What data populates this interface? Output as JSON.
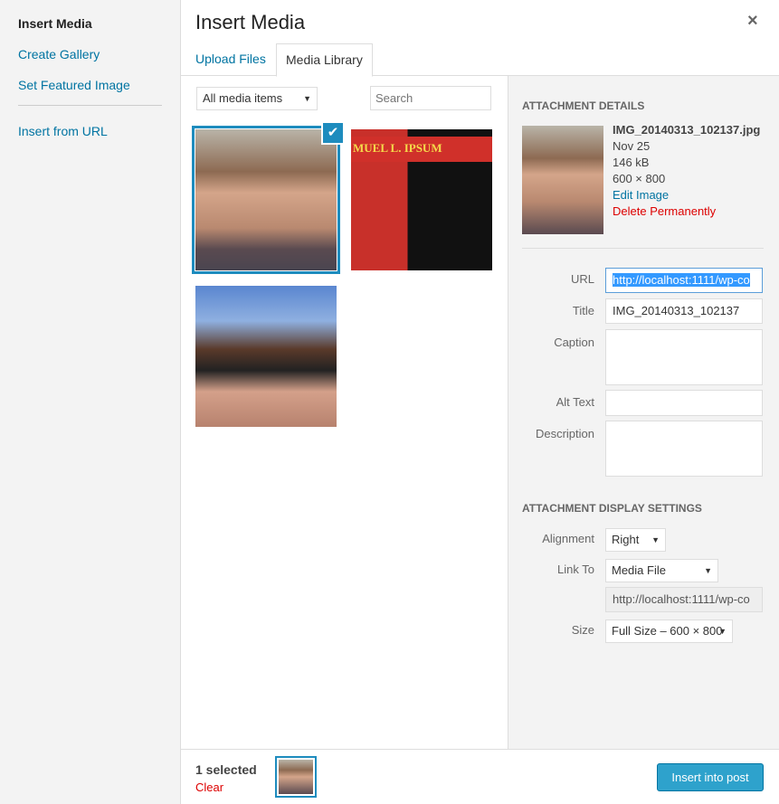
{
  "menu": {
    "items": [
      {
        "label": "Insert Media"
      },
      {
        "label": "Create Gallery"
      },
      {
        "label": "Set Featured Image"
      },
      {
        "label": "Insert from URL"
      }
    ]
  },
  "header": {
    "title": "Insert Media",
    "close_icon": "×"
  },
  "tabs": [
    {
      "label": "Upload Files"
    },
    {
      "label": "Media Library"
    }
  ],
  "toolbar": {
    "filter": "All media items",
    "search_placeholder": "Search"
  },
  "media": [
    {
      "name": "IMG_20140313_102137.jpg",
      "selected": true
    },
    {
      "name": "samuel-l-ipsum",
      "banner": "MUEL L. IPSUM"
    },
    {
      "name": "photo-3"
    }
  ],
  "details": {
    "heading": "Attachment Details",
    "filename": "IMG_20140313_102137.jpg",
    "date": "Nov 25",
    "size": "146 kB",
    "dimensions": "600 × 800",
    "edit": "Edit Image",
    "delete": "Delete Permanently",
    "fields": {
      "url_label": "URL",
      "url": "http://localhost:1111/wp-co",
      "title_label": "Title",
      "title": "IMG_20140313_102137",
      "caption_label": "Caption",
      "alt_label": "Alt Text",
      "description_label": "Description"
    }
  },
  "display": {
    "heading": "Attachment Display Settings",
    "alignment_label": "Alignment",
    "alignment": "Right",
    "link_label": "Link To",
    "link": "Media File",
    "link_url": "http://localhost:1111/wp-co",
    "size_label": "Size",
    "size": "Full Size – 600 × 800"
  },
  "footer": {
    "selected": "1 selected",
    "clear": "Clear",
    "insert": "Insert into post"
  },
  "colors": {
    "accent": "#1e8cbe",
    "link": "#0074a2",
    "danger": "#dd0000",
    "button": "#2ea2cc"
  }
}
